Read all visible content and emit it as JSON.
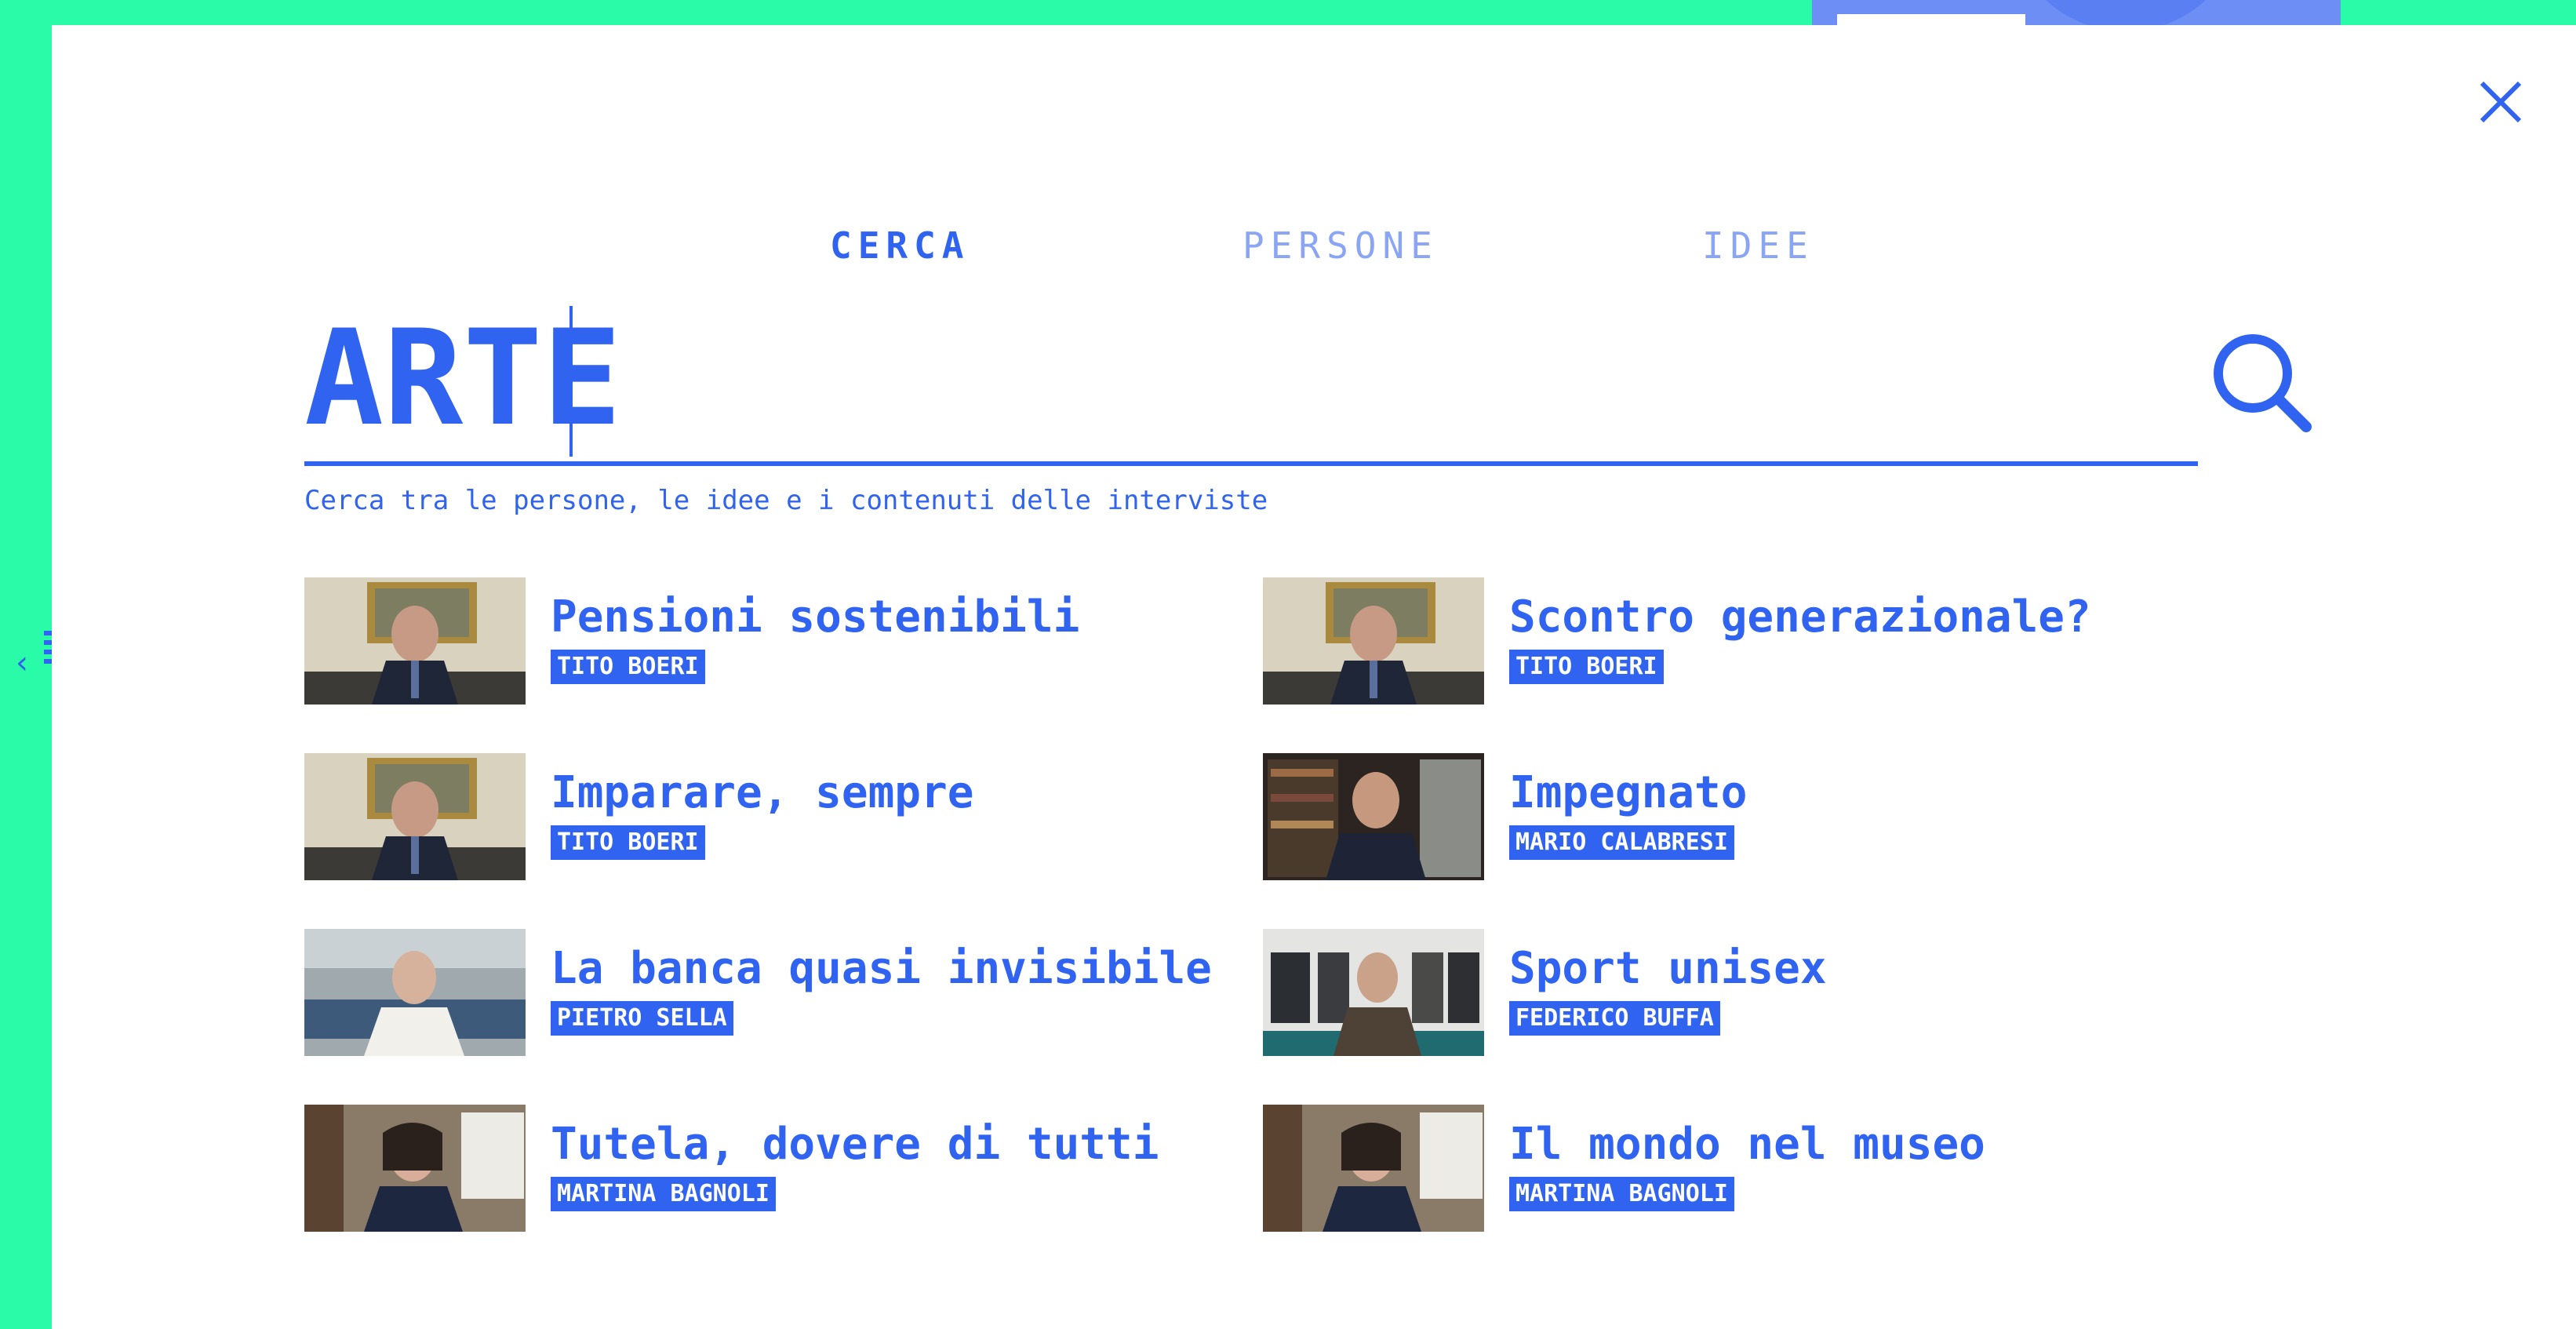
{
  "colors": {
    "accent": "#3064f0",
    "background": "#2afba9",
    "modal": "#ffffff",
    "tab_inactive": "#8aa4f6"
  },
  "tabs": [
    {
      "label": "CERCA",
      "active": true
    },
    {
      "label": "PERSONE",
      "active": false
    },
    {
      "label": "IDEE",
      "active": false
    }
  ],
  "search": {
    "value": "ARTE",
    "hint": "Cerca tra le persone, le idee e i contenuti delle interviste"
  },
  "icons": {
    "close": "close-icon",
    "search": "search-icon",
    "back": "chevron-left-icon"
  },
  "results": [
    {
      "title": "Pensioni sostenibili",
      "author": "TITO BOERI",
      "thumb": "office-painting"
    },
    {
      "title": "Scontro generazionale?",
      "author": "TITO BOERI",
      "thumb": "office-painting"
    },
    {
      "title": "Imparare, sempre",
      "author": "TITO BOERI",
      "thumb": "office-painting"
    },
    {
      "title": "Impegnato",
      "author": "MARIO CALABRESI",
      "thumb": "bookshelf"
    },
    {
      "title": "La banca quasi invisibile",
      "author": "PIETRO SELLA",
      "thumb": "glass-office"
    },
    {
      "title": "Sport unisex",
      "author": "FEDERICO BUFFA",
      "thumb": "locker-room"
    },
    {
      "title": "Tutela, dovere di tutti",
      "author": "MARTINA BAGNOLI",
      "thumb": "living-room"
    },
    {
      "title": "Il mondo nel museo",
      "author": "MARTINA BAGNOLI",
      "thumb": "living-room"
    }
  ]
}
